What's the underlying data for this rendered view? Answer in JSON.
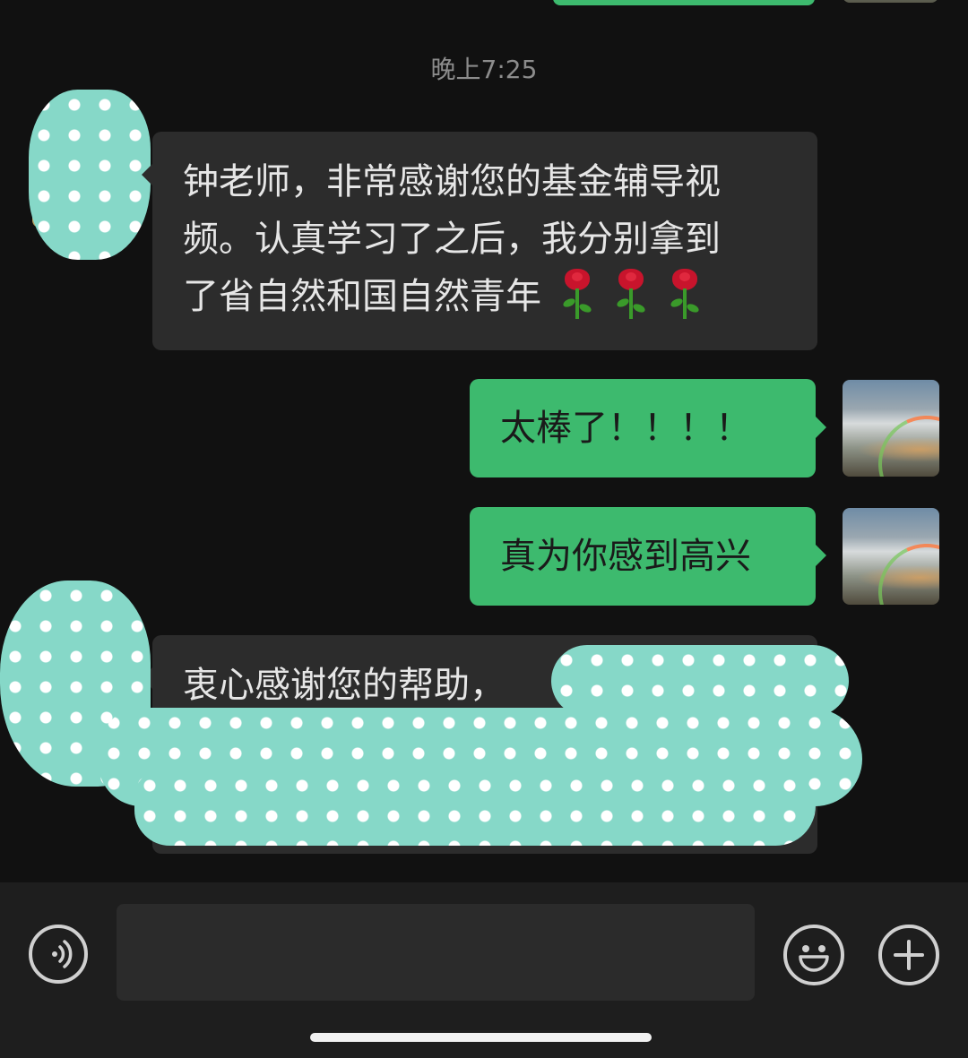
{
  "chat": {
    "timestamp": "晚上7:25",
    "messages": [
      {
        "direction": "incoming",
        "lines": [
          "钟老师，非常感谢您的基金辅导视",
          "频。认真学习了之后，我分别拿到",
          "了省自然和国自然青年"
        ],
        "emoji": [
          "rose",
          "rose",
          "rose"
        ]
      },
      {
        "direction": "outgoing",
        "text": "太棒了！！！！"
      },
      {
        "direction": "outgoing",
        "text": "真为你感到高兴"
      },
      {
        "direction": "incoming",
        "text": "衷心感谢您的帮助，",
        "redacted_overlay": true
      }
    ]
  },
  "input_bar": {
    "placeholder": "",
    "icons": [
      "voice-icon",
      "emoji-icon",
      "plus-icon"
    ]
  },
  "colors": {
    "background": "#111111",
    "incoming_bubble": "#2c2c2c",
    "outgoing_bubble": "#3dba6e",
    "redaction": "#86d8c8"
  }
}
